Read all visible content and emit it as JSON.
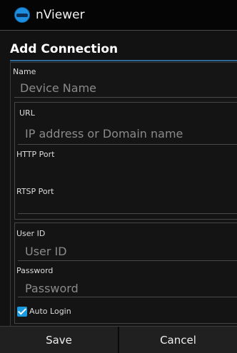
{
  "app": {
    "title": "nViewer",
    "icon": "nviewer-logo-icon"
  },
  "dialog": {
    "title": "Add Connection"
  },
  "form": {
    "name": {
      "label": "Name",
      "placeholder": "Device Name"
    },
    "url": {
      "label": "URL",
      "placeholder": "IP address or Domain name"
    },
    "http_port": {
      "label": "HTTP Port",
      "value": ""
    },
    "rtsp_port": {
      "label": "RTSP Port",
      "value": ""
    },
    "user_id": {
      "label": "User ID",
      "placeholder": "User ID"
    },
    "password": {
      "label": "Password",
      "placeholder": "Password"
    },
    "auto_login": {
      "label": "Auto Login",
      "checked": true
    }
  },
  "buttons": {
    "save": "Save",
    "cancel": "Cancel"
  },
  "colors": {
    "accent": "#1b9ae0",
    "background": "#121212",
    "title_rule": "#2f6b9a"
  }
}
